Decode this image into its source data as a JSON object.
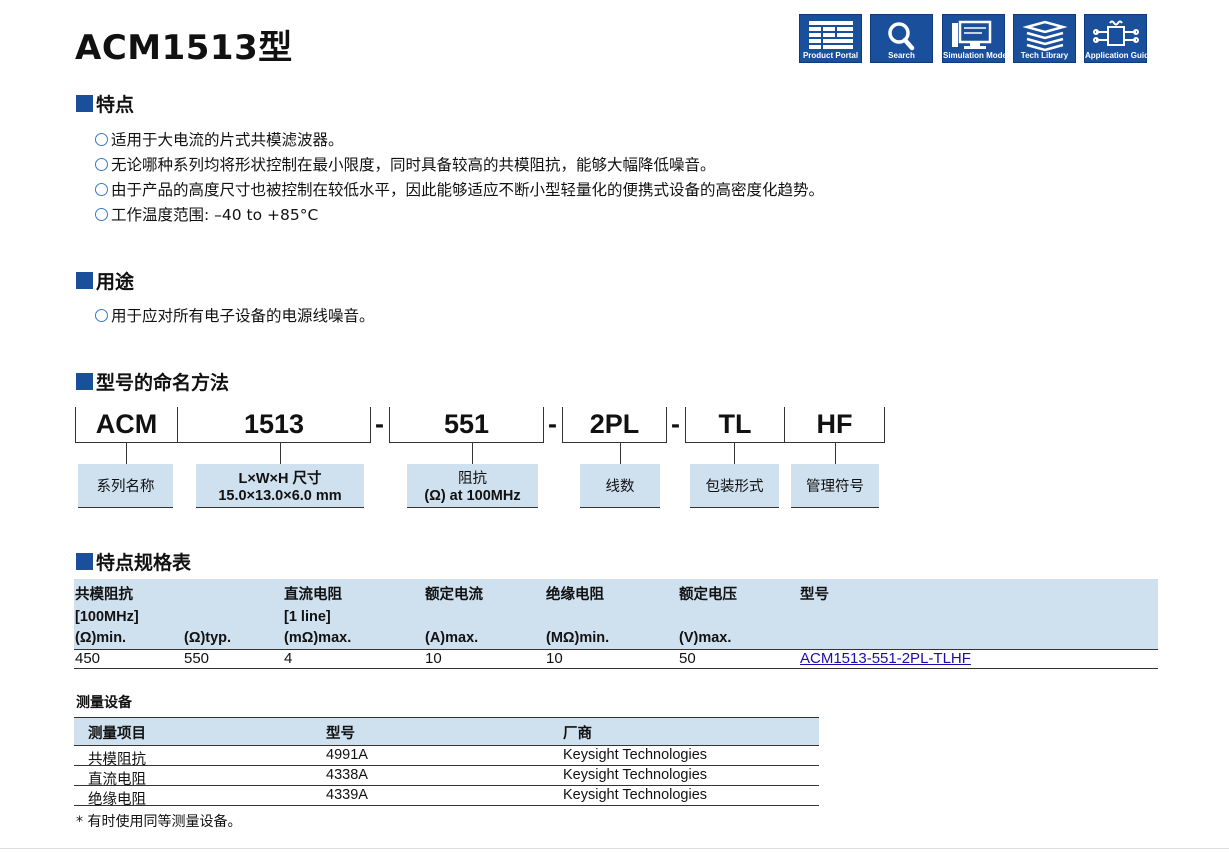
{
  "title": "ACM1513型",
  "header_icons": [
    {
      "label": "Product Portal",
      "icon": "grid-icon"
    },
    {
      "label": "Search",
      "icon": "search-icon"
    },
    {
      "label": "Simulation Model",
      "icon": "computer-icon"
    },
    {
      "label": "Tech Library",
      "icon": "books-icon"
    },
    {
      "label": "Application Guides",
      "icon": "circuit-icon"
    }
  ],
  "sections": {
    "features": "特点",
    "applications": "用途",
    "naming": "型号的命名方法",
    "spec_table": "特点规格表"
  },
  "features": [
    "适用于大电流的片式共模滤波器。",
    "无论哪种系列均将形状控制在最小限度，同时具备较高的共模阻抗，能够大幅降低噪音。",
    "由于产品的高度尺寸也被控制在较低水平，因此能够适应不断小型轻量化的便携式设备的高密度化趋势。",
    "工作温度范围: –40 to +85°C"
  ],
  "applications": [
    "用于应对所有电子设备的电源线噪音。"
  ],
  "naming": {
    "parts": [
      "ACM",
      "1513",
      "551",
      "2PL",
      "TL",
      "HF"
    ],
    "separator": "-",
    "labels": {
      "series": "系列名称",
      "size_l1": "L×W×H 尺寸",
      "size_l2": "15.0×13.0×6.0 mm",
      "imp_l1": "阻抗",
      "imp_l2": "(Ω) at 100MHz",
      "lines": "线数",
      "package": "包装形式",
      "mgmt": "管理符号"
    }
  },
  "spec": {
    "headers": {
      "cm_imp": "共模阻抗",
      "cm_freq": "[100MHz]",
      "min": "(Ω)min.",
      "typ": "(Ω)typ.",
      "dcr": "直流电阻",
      "dcr_line": "[1 line]",
      "dcr_unit": "(mΩ)max.",
      "rated_current": "额定电流",
      "rated_current_unit": "(A)max.",
      "insulation": "绝缘电阻",
      "insulation_unit": "(MΩ)min.",
      "rated_voltage": "额定电压",
      "rated_voltage_unit": "(V)max.",
      "part_no": "型号"
    },
    "row": {
      "min": "450",
      "typ": "550",
      "dcr": "4",
      "current": "10",
      "insulation": "10",
      "voltage": "50",
      "part": "ACM1513-551-2PL-TLHF"
    }
  },
  "measurement": {
    "title": "测量设备",
    "headers": [
      "测量项目",
      "型号",
      "厂商"
    ],
    "rows": [
      [
        "共模阻抗",
        "4991A",
        "Keysight Technologies"
      ],
      [
        "直流电阻",
        "4338A",
        "Keysight Technologies"
      ],
      [
        "绝缘电阻",
        "4339A",
        "Keysight Technologies"
      ]
    ],
    "note": "*  有时使用同等测量设备。"
  },
  "colors": {
    "brand_blue": "#1a4f9c",
    "header_fill": "#cfe0ef",
    "link": "#1a0dab"
  }
}
